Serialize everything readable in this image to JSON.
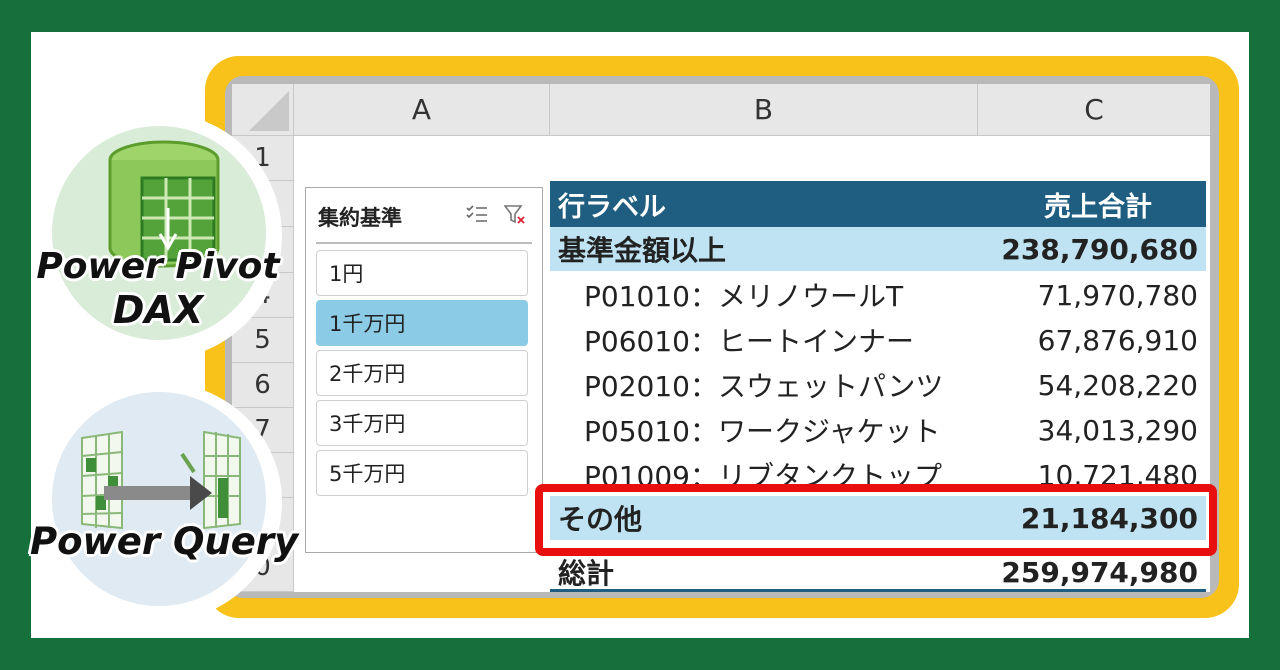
{
  "spreadsheet": {
    "columns": [
      "A",
      "B",
      "C"
    ],
    "rows": [
      "1",
      "",
      "",
      "4",
      "5",
      "6",
      "7",
      "8",
      "",
      "0"
    ]
  },
  "slicer": {
    "title": "集約基準",
    "items": [
      {
        "label": "1円",
        "selected": false
      },
      {
        "label": "1千万円",
        "selected": true
      },
      {
        "label": "2千万円",
        "selected": false
      },
      {
        "label": "3千万円",
        "selected": false
      },
      {
        "label": "5千万円",
        "selected": false
      }
    ]
  },
  "pivot": {
    "header": {
      "label": "行ラベル",
      "value": "売上合計"
    },
    "rows": [
      {
        "label": "基準金額以上",
        "value": "238,790,680",
        "type": "group"
      },
      {
        "label": "P01010：メリノウールT",
        "value": "71,970,780",
        "type": "item"
      },
      {
        "label": "P06010：ヒートインナー",
        "value": "67,876,910",
        "type": "item"
      },
      {
        "label": "P02010：スウェットパンツ",
        "value": "54,208,220",
        "type": "item"
      },
      {
        "label": "P05010：ワークジャケット",
        "value": "34,013,290",
        "type": "item"
      },
      {
        "label": "P01009：リブタンクトップ",
        "value": "10,721,480",
        "type": "item"
      },
      {
        "label": "その他",
        "value": "21,184,300",
        "type": "group"
      }
    ],
    "total": {
      "label": "総計",
      "value": "259,974,980"
    }
  },
  "badges": {
    "top": {
      "line1": "Power Pivot",
      "line2": "DAX"
    },
    "bottom": {
      "line1": "Power Query"
    }
  },
  "colors": {
    "background": "#15703c",
    "frame": "#f8c21a",
    "pivot_header": "#1f5e80",
    "pivot_group": "#bfe3f2",
    "slicer_selected": "#8ccbe6",
    "highlight": "#e8100f"
  }
}
